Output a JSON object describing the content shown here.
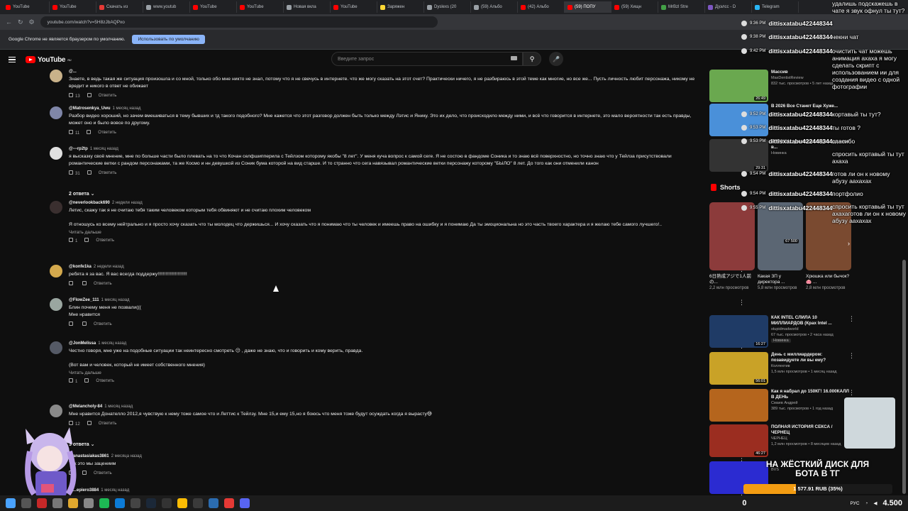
{
  "browser": {
    "tabs": [
      {
        "label": "YouTube",
        "color": "#ff0000"
      },
      {
        "label": "YouTube",
        "color": "#ff0000"
      },
      {
        "label": "Скачать из",
        "color": "#e53935"
      },
      {
        "label": "www.youtub",
        "color": "#9aa0a6"
      },
      {
        "label": "YouTube",
        "color": "#ff0000"
      },
      {
        "label": "YouTube",
        "color": "#ff0000"
      },
      {
        "label": "Новая вкла",
        "color": "#9aa0a6"
      },
      {
        "label": "YouTube",
        "color": "#ff0000"
      },
      {
        "label": "Заряжен",
        "color": "#fdd835"
      },
      {
        "label": "Dyslexs (20",
        "color": "#9aa0a6"
      },
      {
        "label": "(59) Альбо",
        "color": "#9aa0a6"
      },
      {
        "label": "(42) Альбо",
        "color": "#ff0000"
      },
      {
        "label": "(59) ПОПУ",
        "color": "#ff0000",
        "active": true
      },
      {
        "label": "(59) Хищн",
        "color": "#ff0000"
      },
      {
        "label": "MrBzl Stre",
        "color": "#43a047"
      },
      {
        "label": "Дуэлсс - D",
        "color": "#7e57c2"
      },
      {
        "label": "Telegram",
        "color": "#29b6f6"
      }
    ],
    "url": "youtube.com/watch?v=5H8zJbAQPxo",
    "infobar_text": "Google Chrome не является браузером по умолчанию.",
    "infobar_button": "Использовать по умолчанию"
  },
  "youtube": {
    "logo_text": "YouTube",
    "logo_sup": "RU",
    "search_placeholder": "Введите запрос"
  },
  "comments": [
    {
      "author": "@...",
      "time": "",
      "text": "Знаете, в ведь такая же ситуация произошла и со мной, только обо мне никто не знал, потому что я не свечусь в интернете. что же могу сказать на этот счет? Практически ничего, я не разбираюсь в этой теме как многие, но все же... Пусть личность любит персонажа, никому не вредит и никого в ответ не обижает",
      "likes": "13",
      "reply": "Ответить",
      "avatar": "#c9b28a"
    },
    {
      "author": "@Matrosenkya_Uwu",
      "time": "1 месяц назад",
      "text": "Разбор видео хороший, но зачем вмешиваться в тему бывших и тд такого подобного? Мне кажется что этот разговор должен быть только между Лэтис и Янику. Это их дело, что происходило между ними, и всё что говорится в интернете, это мало вероятности так есть правды, может оно и было вовсе по другому.",
      "likes": "11",
      "reply": "Ответить",
      "avatar": "#7f86a8"
    },
    {
      "author": "@---rp2tp",
      "time": "1 месяц назад",
      "text": "я высказку своё мнение, мне по больше части было плевать на то что Кочан селфшипперила с Тейлзом которому якобы \"8 лет\". У меня куча вопрос к самой сеге. Я не состою в фандоме Соника и то знаю всё поверхностно, но точно знаю что у Тейлза присутствовали романтические ветки с рандом персонажами, та же Космо и нн девушкой из Соник бума которой на вид старше. И то странно что сега навязывал романтические ветки персонажу которому \"БЫЛО\" 8 лет. До того как они отменили канон",
      "likes": "31",
      "reply": "Ответить",
      "avatar": "#e0e0e0"
    },
    {
      "author": "@neverlookback690",
      "time": "2 недели назад",
      "text": "Летис, скажу так я не считаю тебя таким человеком которым тебя обвиняют и не считаю плохим человеком",
      "text2": "Я отношусь ко всему нейтрально и я просто хочу сказать что ты молодец что держишься... И хочу сказать что я понимаю что ты человек и имеешь право на ошибку и я понимаю Да ты эмоциональна но это часть твоего характера и я желаю тебе самого лучшего!..",
      "more": "Читать дальше",
      "likes": "1",
      "reply": "Ответить",
      "avatar": "#3a2f2f"
    },
    {
      "author": "@konfe1ka",
      "time": "2 недели назад",
      "text": "ребята я за вас. Я вас всегда поддержу!!!!!!!!!!!!!!!!!!!!!!",
      "likes": "",
      "reply": "Ответить",
      "avatar": "#d4a94d"
    },
    {
      "author": "@FlowZee_111",
      "time": "1 месяц назад",
      "text": "Блин почему меня не позвали(((",
      "text2": "Мне нравится",
      "likes": "",
      "reply": "Ответить",
      "avatar": "#9aa6a0"
    },
    {
      "author": "@JonMelissa",
      "time": "1 месяц назад",
      "text": "Честно говоря, мне уже на подобные ситуации так неинтересно смотреть 😐 , даже не знаю, что и говорить и кому верить, правда.",
      "text2": "(Вот вам и человек, который не имеет собственного мнения)",
      "more": "Читать дальше",
      "likes": "1",
      "reply": "Ответить",
      "avatar": "#555a66"
    },
    {
      "author": "@Melancholy-84",
      "time": "1 месяц назад",
      "text": "Мне нравится Донателло 2012,я чувствую к нему тоже самое что и Леттис к Тейлзу. Мне 15,и ему 15,но я боюсь что меня тоже будут осуждать когда я вырасту😅",
      "likes": "12",
      "reply": "Ответить",
      "avatar": "#8a8a8a"
    },
    {
      "author": "@anastasiakas3861",
      "time": "2 месяца назад",
      "text": "Так это мы зацениим",
      "likes": "",
      "reply": "Ответить",
      "avatar": "#3e7b3e"
    },
    {
      "author": "@...epiero3884",
      "time": "1 месяц назад",
      "text": "",
      "likes": "",
      "reply": "",
      "avatar": "#999"
    }
  ],
  "reply_toggles": [
    "2 ответа",
    "3 ответа"
  ],
  "sidebar": {
    "videos_top": [
      {
        "title": "Массив",
        "channel": "MaxDentistReview",
        "meta": "832 тыс. просмотров • 5 лет назад",
        "dur": "26:49",
        "thumb": "#6aa84f"
      },
      {
        "title": "В 2026 Все Станет Еще Хуже...",
        "channel": "",
        "meta": "",
        "dur": "",
        "thumb": "#4a90d9"
      },
      {
        "title": "ИГРОКИ... уничтожили рекорд века в...",
        "channel": "Новинка",
        "meta": "",
        "dur": "29:31",
        "thumb": "#333"
      }
    ],
    "shorts_title": "Shorts",
    "shorts": [
      {
        "title": "6日熟成アジで1人前の...",
        "views": "2,2 млн просмотров",
        "color": "#8c3b3b"
      },
      {
        "title": "Какая ЗП у директора ...",
        "views": "5,8 млн просмотров",
        "color": "#5b6673"
      },
      {
        "title": "Хрюшка или бычок? 🐽 ...",
        "views": "2,8 млн просмотров",
        "color": "#7a4a30"
      }
    ],
    "shorts_views_badge": "67 500",
    "videos": [
      {
        "title": "КАК INTEL СЛИЛА 10 МИЛЛИАРДОВ (Крах Intel ...",
        "channel": "stupidmadworld",
        "meta": "67 тыс. просмотров • 2 часа назад",
        "badge": "Новинка",
        "dur": "16:27",
        "thumb": "#1f3b66"
      },
      {
        "title": "День с миллиардером: позавидуете ли вы ему?",
        "channel": "Коллектив",
        "meta": "1,5 млн просмотров • 1 месяц назад",
        "badge": "",
        "dur": "56:01",
        "thumb": "#c9a227"
      },
      {
        "title": "Как я набрал до 150КГ! 16.000КАЛЛ В ДЕНЬ",
        "channel": "Смаев Андрей",
        "meta": "389 тыс. просмотров • 1 год назад",
        "badge": "",
        "dur": "",
        "thumb": "#b5651d"
      },
      {
        "title": "ПОЛНАЯ ИСТОРИЯ СЕКСА / ЧЕРНЕЦ",
        "channel": "ЧЕРНЕЦ",
        "meta": "1,2 млн просмотров • 8 месяцев назад",
        "badge": "",
        "dur": "46:27",
        "thumb": "#9b2d20"
      },
      {
        "title": "...",
        "channel": "BVS",
        "meta": "",
        "badge": "",
        "dur": "",
        "thumb": "#2b2bd1"
      }
    ]
  },
  "stream_overlay": {
    "chat": [
      {
        "time": "9:36 PM",
        "user": "dittisxatabu422448344",
        "msg": "удалишь подскажешь в чате я звук офнул ты тут?"
      },
      {
        "time": "9:38 PM",
        "user": "dittisxatabu422448344",
        "msg": "чекни чат"
      },
      {
        "time": "9:42 PM",
        "user": "dittisxatabu422448344",
        "msg": "очистить чат можешь анимация ахаха я могу сделать скрипт с использованием ии для создания видео с одной фотографии"
      },
      {
        "time": "9:52 PM",
        "user": "dittisxatabu422448344",
        "msg": "кортавый ты тут?"
      },
      {
        "time": "9:53 PM",
        "user": "dittisxatabu422448344",
        "msg": "ты готов ?"
      },
      {
        "time": "9:53 PM",
        "user": "dittisxatabu422448344",
        "msg": "спасибо"
      },
      {
        "time": "9:54 PM",
        "user": "dittisxatabu422448344",
        "msg": "спросить кортавый ты тут ахаха"
      },
      {
        "time": "9:54 PM",
        "user": "dittisxatabu422448344",
        "msg": "готов ли он к новому абузу аахахах"
      },
      {
        "time": "9:55 PM",
        "user": "dittisxatabu422448344",
        "msg": "портфолио"
      },
      {
        "time": "9:58 PM",
        "user": "dittisxatabu422448344",
        "msg": "спросить кортавый ты тут ахахаготов ли он к новому абузу аахахах"
      }
    ],
    "goal_title": "НА ЖЁСТКИЙ ДИСК ДЛЯ БОТА В ТГ",
    "goal_amount": "1 577.91 RUB (35%)",
    "goal_fraction": 0.35
  },
  "taskbar": {
    "left_counter": "0",
    "lang": "РУС",
    "clock": "4.500"
  }
}
